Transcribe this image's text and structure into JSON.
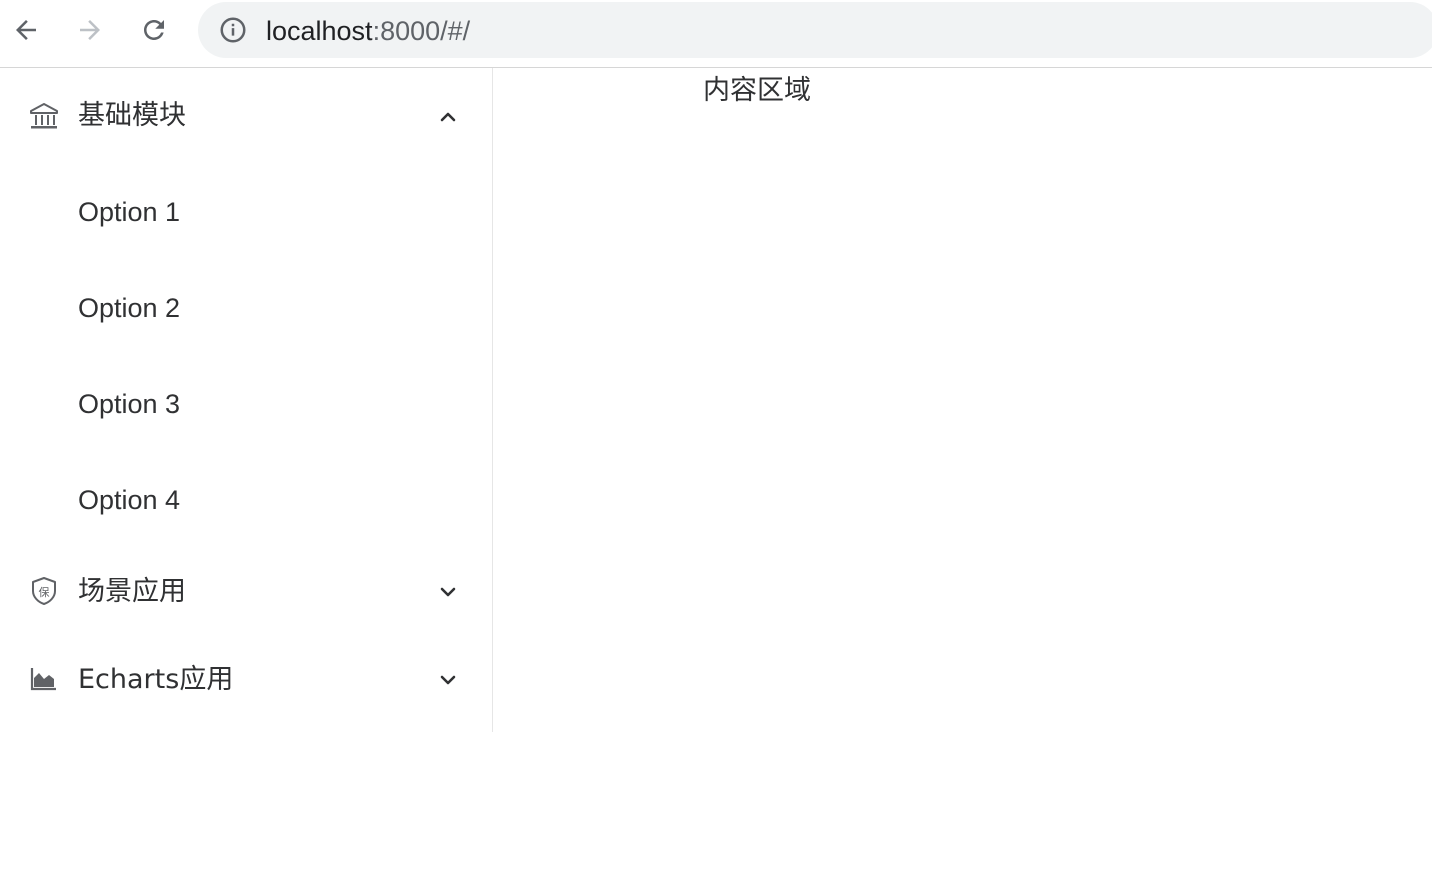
{
  "browser": {
    "back_icon": "arrow-left-icon",
    "forward_icon": "arrow-right-icon",
    "reload_icon": "reload-icon",
    "info_icon": "info-icon",
    "url_host": "localhost",
    "url_rest": ":8000/#/"
  },
  "sidebar": {
    "groups": [
      {
        "label": "基础模块",
        "icon": "bank-icon",
        "expanded": true,
        "items": [
          "Option 1",
          "Option 2",
          "Option 3",
          "Option 4"
        ]
      },
      {
        "label": "场景应用",
        "icon": "insurance-shield-icon",
        "expanded": false,
        "items": []
      },
      {
        "label": "Echarts应用",
        "icon": "area-chart-icon",
        "expanded": false,
        "items": []
      }
    ]
  },
  "main": {
    "content_label": "内容区域"
  },
  "colors": {
    "text": "#303133",
    "icon": "#606266",
    "omnibox_bg": "#f1f3f4",
    "border": "#e6e6e6"
  }
}
